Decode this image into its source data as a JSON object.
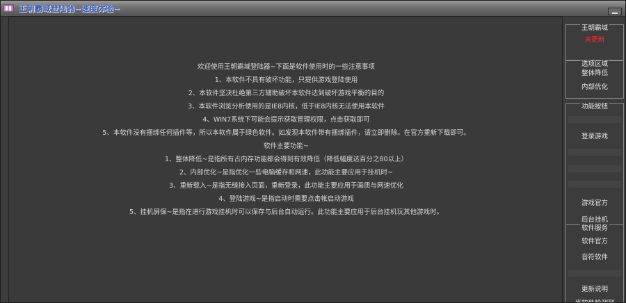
{
  "window": {
    "title": "王朝霸域登陆器~速度体验~"
  },
  "notes": {
    "lines": [
      "欢迎使用王朝霸域登陆器~下面是软件使用时的一些注意事项",
      "1、本软件不具有破坏功能，只提供游戏登陆使用",
      "2、本软件坚决杜绝第三方辅助破坏本软件达到破坏游戏平衡的目的",
      "3、本软件浏览分析使用的是IE8内核，低于IE8内核无法使用本软件",
      "4、WIN7系统下可能会提示获取管理权限，点击获取即可",
      "5、本软件没有捆绑任何插件等，所以本软件属于绿色软件。如发现本软件带有捆绑插件，请立即删除。在官方重新下载即可。",
      "软件主要功能~",
      "1、整体降低~是指所有占内存功能都会得到有效降低（降低幅度达百分之80以上）",
      "2、内部优化~是指优化一些电脑缓存和网速，此功能主要应用于挂机时~",
      "3、重新载入~是指无缝接入页面，重新登录，此功能主要应用于画质与网速优化",
      "4、登陆游戏~是指启动时需要点击帐启动游戏",
      "5、挂机屏保~是指在进行游戏挂机时可以保存与后台自动运行。此功能主要应用于后台挂机玩其他游戏时。"
    ]
  },
  "sidebar": {
    "server_group": {
      "title": "王朝霸域",
      "status": "未更新"
    },
    "region_group": {
      "title": "选项区域",
      "items": [
        "整体降低",
        "内部优化"
      ]
    },
    "func_group": {
      "title": "功能按钮",
      "login": "登录游戏",
      "official": "游戏官方",
      "hang": "后台挂机"
    },
    "service_group": {
      "title": "软件服务",
      "official": "软件官方",
      "music": "音符软件",
      "update": "更新说明",
      "check": "当软件检测到"
    }
  },
  "colors": {
    "status_red": "#ff2a2a",
    "title_blue": "#3f5fae",
    "background": "#3c3c3c"
  }
}
